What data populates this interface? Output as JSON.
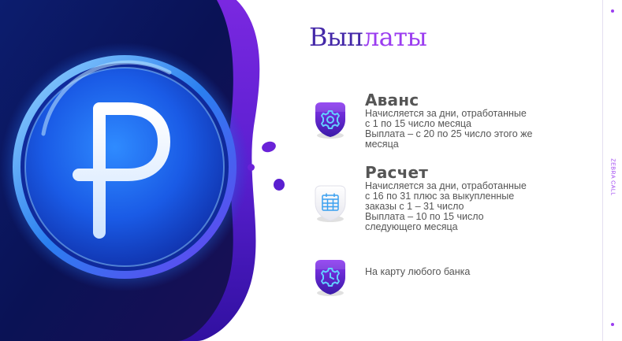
{
  "title": {
    "part1": "Вып",
    "part2": "латы"
  },
  "brand": "ZEBRA CALL",
  "sections": [
    {
      "heading": "Аванс",
      "icon": "gear-icon",
      "lines": [
        "Начисляется за дни, отработанные",
        "с 1 по 15 число месяца",
        "Выплата – с 20 по 25  число этого же",
        "месяца"
      ]
    },
    {
      "heading": "Расчет",
      "icon": "calendar-icon",
      "lines": [
        "Начисляется за дни, отработанные",
        "с 16 по 31 плюс за выкупленные",
        "заказы с 1 – 31 число",
        "Выплата – 10 по 15  число",
        "следующего месяца"
      ]
    },
    {
      "heading": "",
      "icon": "clock-gear-icon",
      "lines": [
        "На карту любого банка"
      ]
    }
  ],
  "colors": {
    "accent": "#9b3df0",
    "title_dark": "#4428a8",
    "text": "#555555",
    "navy": "#0d1450",
    "coin_blue": "#1e6ff0"
  }
}
